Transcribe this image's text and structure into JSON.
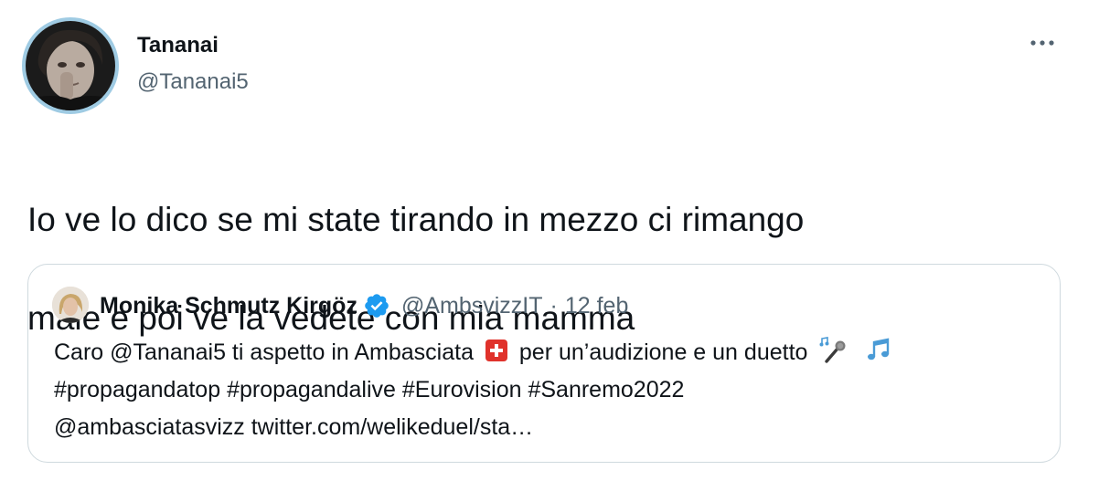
{
  "author": {
    "name": "Tananai",
    "handle": "@Tananai5"
  },
  "more_icon": "more-horizontal-icon",
  "tweet": {
    "text_line_1": "Io ve lo dico se mi state tirando in mezzo ci rimango",
    "text_line_2": "male e poi ve la vedete con mia mamma"
  },
  "quoted_tweet": {
    "author_name": "Monika Schmutz Kirgöz",
    "verified_icon": "verified-badge-icon",
    "handle": "@AmbsvizzIT",
    "separator": "·",
    "date": "12 feb",
    "line1_part1": "Caro @Tananai5 ti aspetto in Ambasciata",
    "line1_part2": "per un’audizione e un duetto",
    "emojis": [
      "swiss-flag-icon",
      "microphone-icon",
      "musical-notes-icon"
    ],
    "line2": "#propagandatop #propagandalive #Eurovision #Sanremo2022",
    "line3": "@ambasciatasvizz twitter.com/welikeduel/sta…"
  },
  "colors": {
    "text_primary": "#0f1419",
    "text_secondary": "#536471",
    "verified": "#1d9bf0",
    "border": "#cfd9de",
    "swiss_red": "#e0322b"
  }
}
